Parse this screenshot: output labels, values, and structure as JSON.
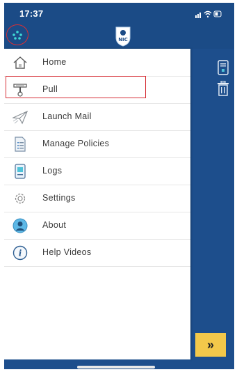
{
  "status_bar": {
    "time": "17:37"
  },
  "app_logo": {
    "text": "NIC"
  },
  "menu": {
    "items": [
      {
        "label": "Home",
        "icon": "home-icon"
      },
      {
        "label": "Pull",
        "icon": "pull-icon"
      },
      {
        "label": "Launch Mail",
        "icon": "paper-plane-icon"
      },
      {
        "label": "Manage Policies",
        "icon": "document-list-icon"
      },
      {
        "label": "Logs",
        "icon": "logs-icon"
      },
      {
        "label": "Settings",
        "icon": "gear-icon"
      },
      {
        "label": "About",
        "icon": "person-icon"
      },
      {
        "label": "Help Videos",
        "icon": "info-icon"
      }
    ]
  },
  "next_button": {
    "label": "»"
  },
  "colors": {
    "primary": "#1d4e8c",
    "accent": "#f3c84a",
    "highlight": "#d62f36"
  }
}
